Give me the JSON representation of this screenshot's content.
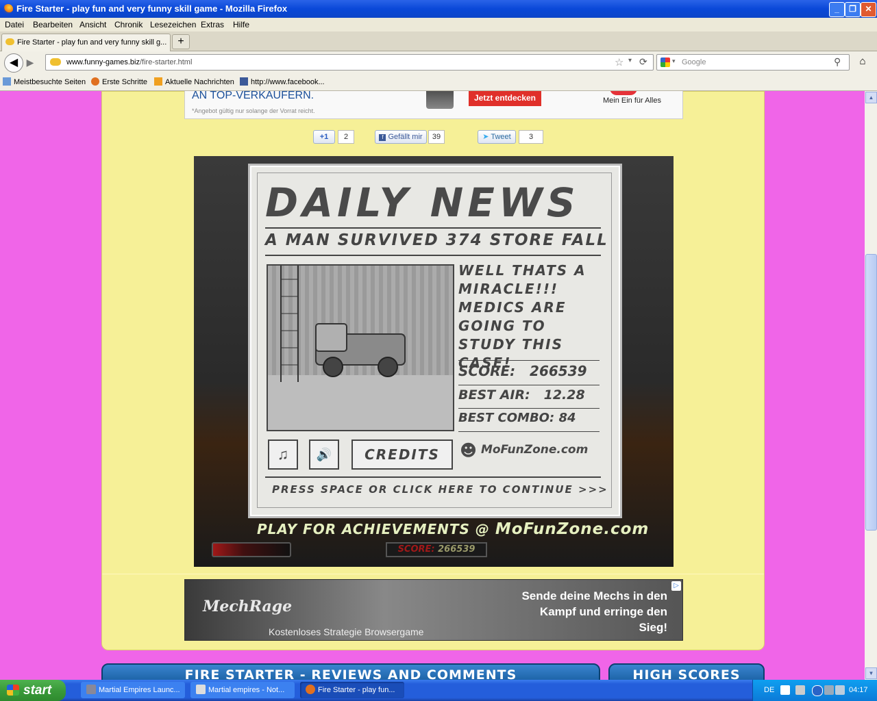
{
  "window": {
    "title": "Fire Starter - play fun and very funny skill game - Mozilla Firefox",
    "controls": [
      "_",
      "❐",
      "✕"
    ]
  },
  "menu": [
    "Datei",
    "Bearbeiten",
    "Ansicht",
    "Chronik",
    "Lesezeichen",
    "Extras",
    "Hilfe"
  ],
  "tab": {
    "label": "Fire Starter - play fun and very funny skill g...",
    "new_tab": "+"
  },
  "nav": {
    "url_domain": "www.funny-games.biz",
    "url_path": "/fire-starter.html",
    "search_placeholder": "Google"
  },
  "bookmarks": [
    "Meistbesuchte Seiten",
    "Erste Schritte",
    "Aktuelle Nachrichten",
    "http://www.facebook..."
  ],
  "ad_top": {
    "headline": "AN TOP-VERKÄUFERN.",
    "disclaimer": "*Angebot gültig nur solange der Vorrat reicht.",
    "cta": "Jetzt entdecken",
    "tagline": "Mein Ein für Alles"
  },
  "social": {
    "gplus_label": "+1",
    "gplus_count": "2",
    "fb_label": "Gefällt mir",
    "fb_count": "39",
    "tw_label": "Tweet",
    "tw_count": "3"
  },
  "game": {
    "masthead": "DAILY NEWS",
    "subhead": "A MAN SURVIVED 374 STORE FALL",
    "story": "WELL THATS A MIRACLE!!! MEDICS ARE GOING TO STUDY THIS CASE!",
    "score_label": "SCORE:",
    "score_value": "266539",
    "best_air_label": "BEST AIR:",
    "best_air_value": "12.28",
    "best_combo_label": "BEST COMBO:",
    "best_combo_value": "84",
    "music_icon": "♫",
    "sound_icon": "🔊",
    "credits": "CREDITS",
    "brand": "MoFunZone.com",
    "continue": "PRESS SPACE OR CLICK HERE TO CONTINUE >>>",
    "achievements_prefix": "PLAY FOR ACHIEVEMENTS @ ",
    "achievements_site": "MoFunZone.com",
    "hud_score_label": "SCORE:",
    "hud_score_value": "266539"
  },
  "ad_bottom": {
    "logo": "MechRage",
    "subtitle": "Kostenloses Strategie Browsergame",
    "message": "Sende deine Mechs in den Kampf und erringe den Sieg!",
    "info_icon": "▷"
  },
  "sections": {
    "reviews": "FIRE STARTER - REVIEWS AND COMMENTS",
    "highscores": "HIGH SCORES"
  },
  "taskbar": {
    "start": "start",
    "tasks": [
      "Martial Empires Launc...",
      "Martial empires - Not...",
      "Fire Starter - play fun..."
    ],
    "lang": "DE",
    "time": "04:17"
  },
  "colors": {
    "page_bg": "#f065e8",
    "panel_bg": "#f6f097",
    "xp_blue": "#245edb"
  }
}
